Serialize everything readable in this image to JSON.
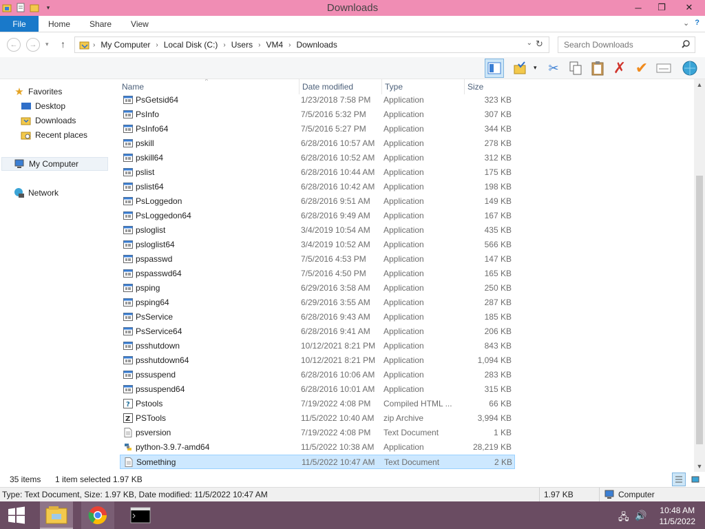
{
  "window": {
    "title": "Downloads"
  },
  "ribbon": {
    "tabs": [
      "File",
      "Home",
      "Share",
      "View"
    ]
  },
  "address": {
    "crumbs": [
      "My Computer",
      "Local Disk (C:)",
      "Users",
      "VM4",
      "Downloads"
    ],
    "search_placeholder": "Search Downloads"
  },
  "nav": {
    "favorites": "Favorites",
    "desktop": "Desktop",
    "downloads": "Downloads",
    "recent": "Recent places",
    "computer": "My Computer",
    "network": "Network"
  },
  "columns": {
    "name": "Name",
    "date": "Date modified",
    "type": "Type",
    "size": "Size"
  },
  "files": [
    {
      "name": "PsGetsid64",
      "date": "1/23/2018 7:58 PM",
      "type": "Application",
      "size": "323 KB",
      "icon": "app"
    },
    {
      "name": "PsInfo",
      "date": "7/5/2016 5:32 PM",
      "type": "Application",
      "size": "307 KB",
      "icon": "app"
    },
    {
      "name": "PsInfo64",
      "date": "7/5/2016 5:27 PM",
      "type": "Application",
      "size": "344 KB",
      "icon": "app"
    },
    {
      "name": "pskill",
      "date": "6/28/2016 10:57 AM",
      "type": "Application",
      "size": "278 KB",
      "icon": "app"
    },
    {
      "name": "pskill64",
      "date": "6/28/2016 10:52 AM",
      "type": "Application",
      "size": "312 KB",
      "icon": "app"
    },
    {
      "name": "pslist",
      "date": "6/28/2016 10:44 AM",
      "type": "Application",
      "size": "175 KB",
      "icon": "app"
    },
    {
      "name": "pslist64",
      "date": "6/28/2016 10:42 AM",
      "type": "Application",
      "size": "198 KB",
      "icon": "app"
    },
    {
      "name": "PsLoggedon",
      "date": "6/28/2016 9:51 AM",
      "type": "Application",
      "size": "149 KB",
      "icon": "app"
    },
    {
      "name": "PsLoggedon64",
      "date": "6/28/2016 9:49 AM",
      "type": "Application",
      "size": "167 KB",
      "icon": "app"
    },
    {
      "name": "psloglist",
      "date": "3/4/2019 10:54 AM",
      "type": "Application",
      "size": "435 KB",
      "icon": "app"
    },
    {
      "name": "psloglist64",
      "date": "3/4/2019 10:52 AM",
      "type": "Application",
      "size": "566 KB",
      "icon": "app"
    },
    {
      "name": "pspasswd",
      "date": "7/5/2016 4:53 PM",
      "type": "Application",
      "size": "147 KB",
      "icon": "app"
    },
    {
      "name": "pspasswd64",
      "date": "7/5/2016 4:50 PM",
      "type": "Application",
      "size": "165 KB",
      "icon": "app"
    },
    {
      "name": "psping",
      "date": "6/29/2016 3:58 AM",
      "type": "Application",
      "size": "250 KB",
      "icon": "app"
    },
    {
      "name": "psping64",
      "date": "6/29/2016 3:55 AM",
      "type": "Application",
      "size": "287 KB",
      "icon": "app"
    },
    {
      "name": "PsService",
      "date": "6/28/2016 9:43 AM",
      "type": "Application",
      "size": "185 KB",
      "icon": "app"
    },
    {
      "name": "PsService64",
      "date": "6/28/2016 9:41 AM",
      "type": "Application",
      "size": "206 KB",
      "icon": "app"
    },
    {
      "name": "psshutdown",
      "date": "10/12/2021 8:21 PM",
      "type": "Application",
      "size": "843 KB",
      "icon": "app"
    },
    {
      "name": "psshutdown64",
      "date": "10/12/2021 8:21 PM",
      "type": "Application",
      "size": "1,094 KB",
      "icon": "app"
    },
    {
      "name": "pssuspend",
      "date": "6/28/2016 10:06 AM",
      "type": "Application",
      "size": "283 KB",
      "icon": "app"
    },
    {
      "name": "pssuspend64",
      "date": "6/28/2016 10:01 AM",
      "type": "Application",
      "size": "315 KB",
      "icon": "app"
    },
    {
      "name": "Pstools",
      "date": "7/19/2022 4:08 PM",
      "type": "Compiled HTML ...",
      "size": "66 KB",
      "icon": "help"
    },
    {
      "name": "PSTools",
      "date": "11/5/2022 10:40 AM",
      "type": "zip Archive",
      "size": "3,994 KB",
      "icon": "zip"
    },
    {
      "name": "psversion",
      "date": "7/19/2022 4:08 PM",
      "type": "Text Document",
      "size": "1 KB",
      "icon": "txt"
    },
    {
      "name": "python-3.9.7-amd64",
      "date": "11/5/2022 10:38 AM",
      "type": "Application",
      "size": "28,219 KB",
      "icon": "python"
    },
    {
      "name": "Something",
      "date": "11/5/2022 10:47 AM",
      "type": "Text Document",
      "size": "2 KB",
      "icon": "txt",
      "selected": true
    }
  ],
  "status": {
    "count": "35 items",
    "selected": "1 item selected",
    "selected_size": "1.97 KB",
    "details": "Type: Text Document, Size: 1.97 KB, Date modified: 11/5/2022 10:47 AM",
    "size": "1.97 KB",
    "location": "Computer"
  },
  "clock": {
    "time": "10:48 AM",
    "date": "11/5/2022"
  },
  "colors": {
    "titlebar": "#f08db4",
    "file_tab": "#1979ca",
    "taskbar": "#6a4c62",
    "selection": "#cde8ff"
  }
}
